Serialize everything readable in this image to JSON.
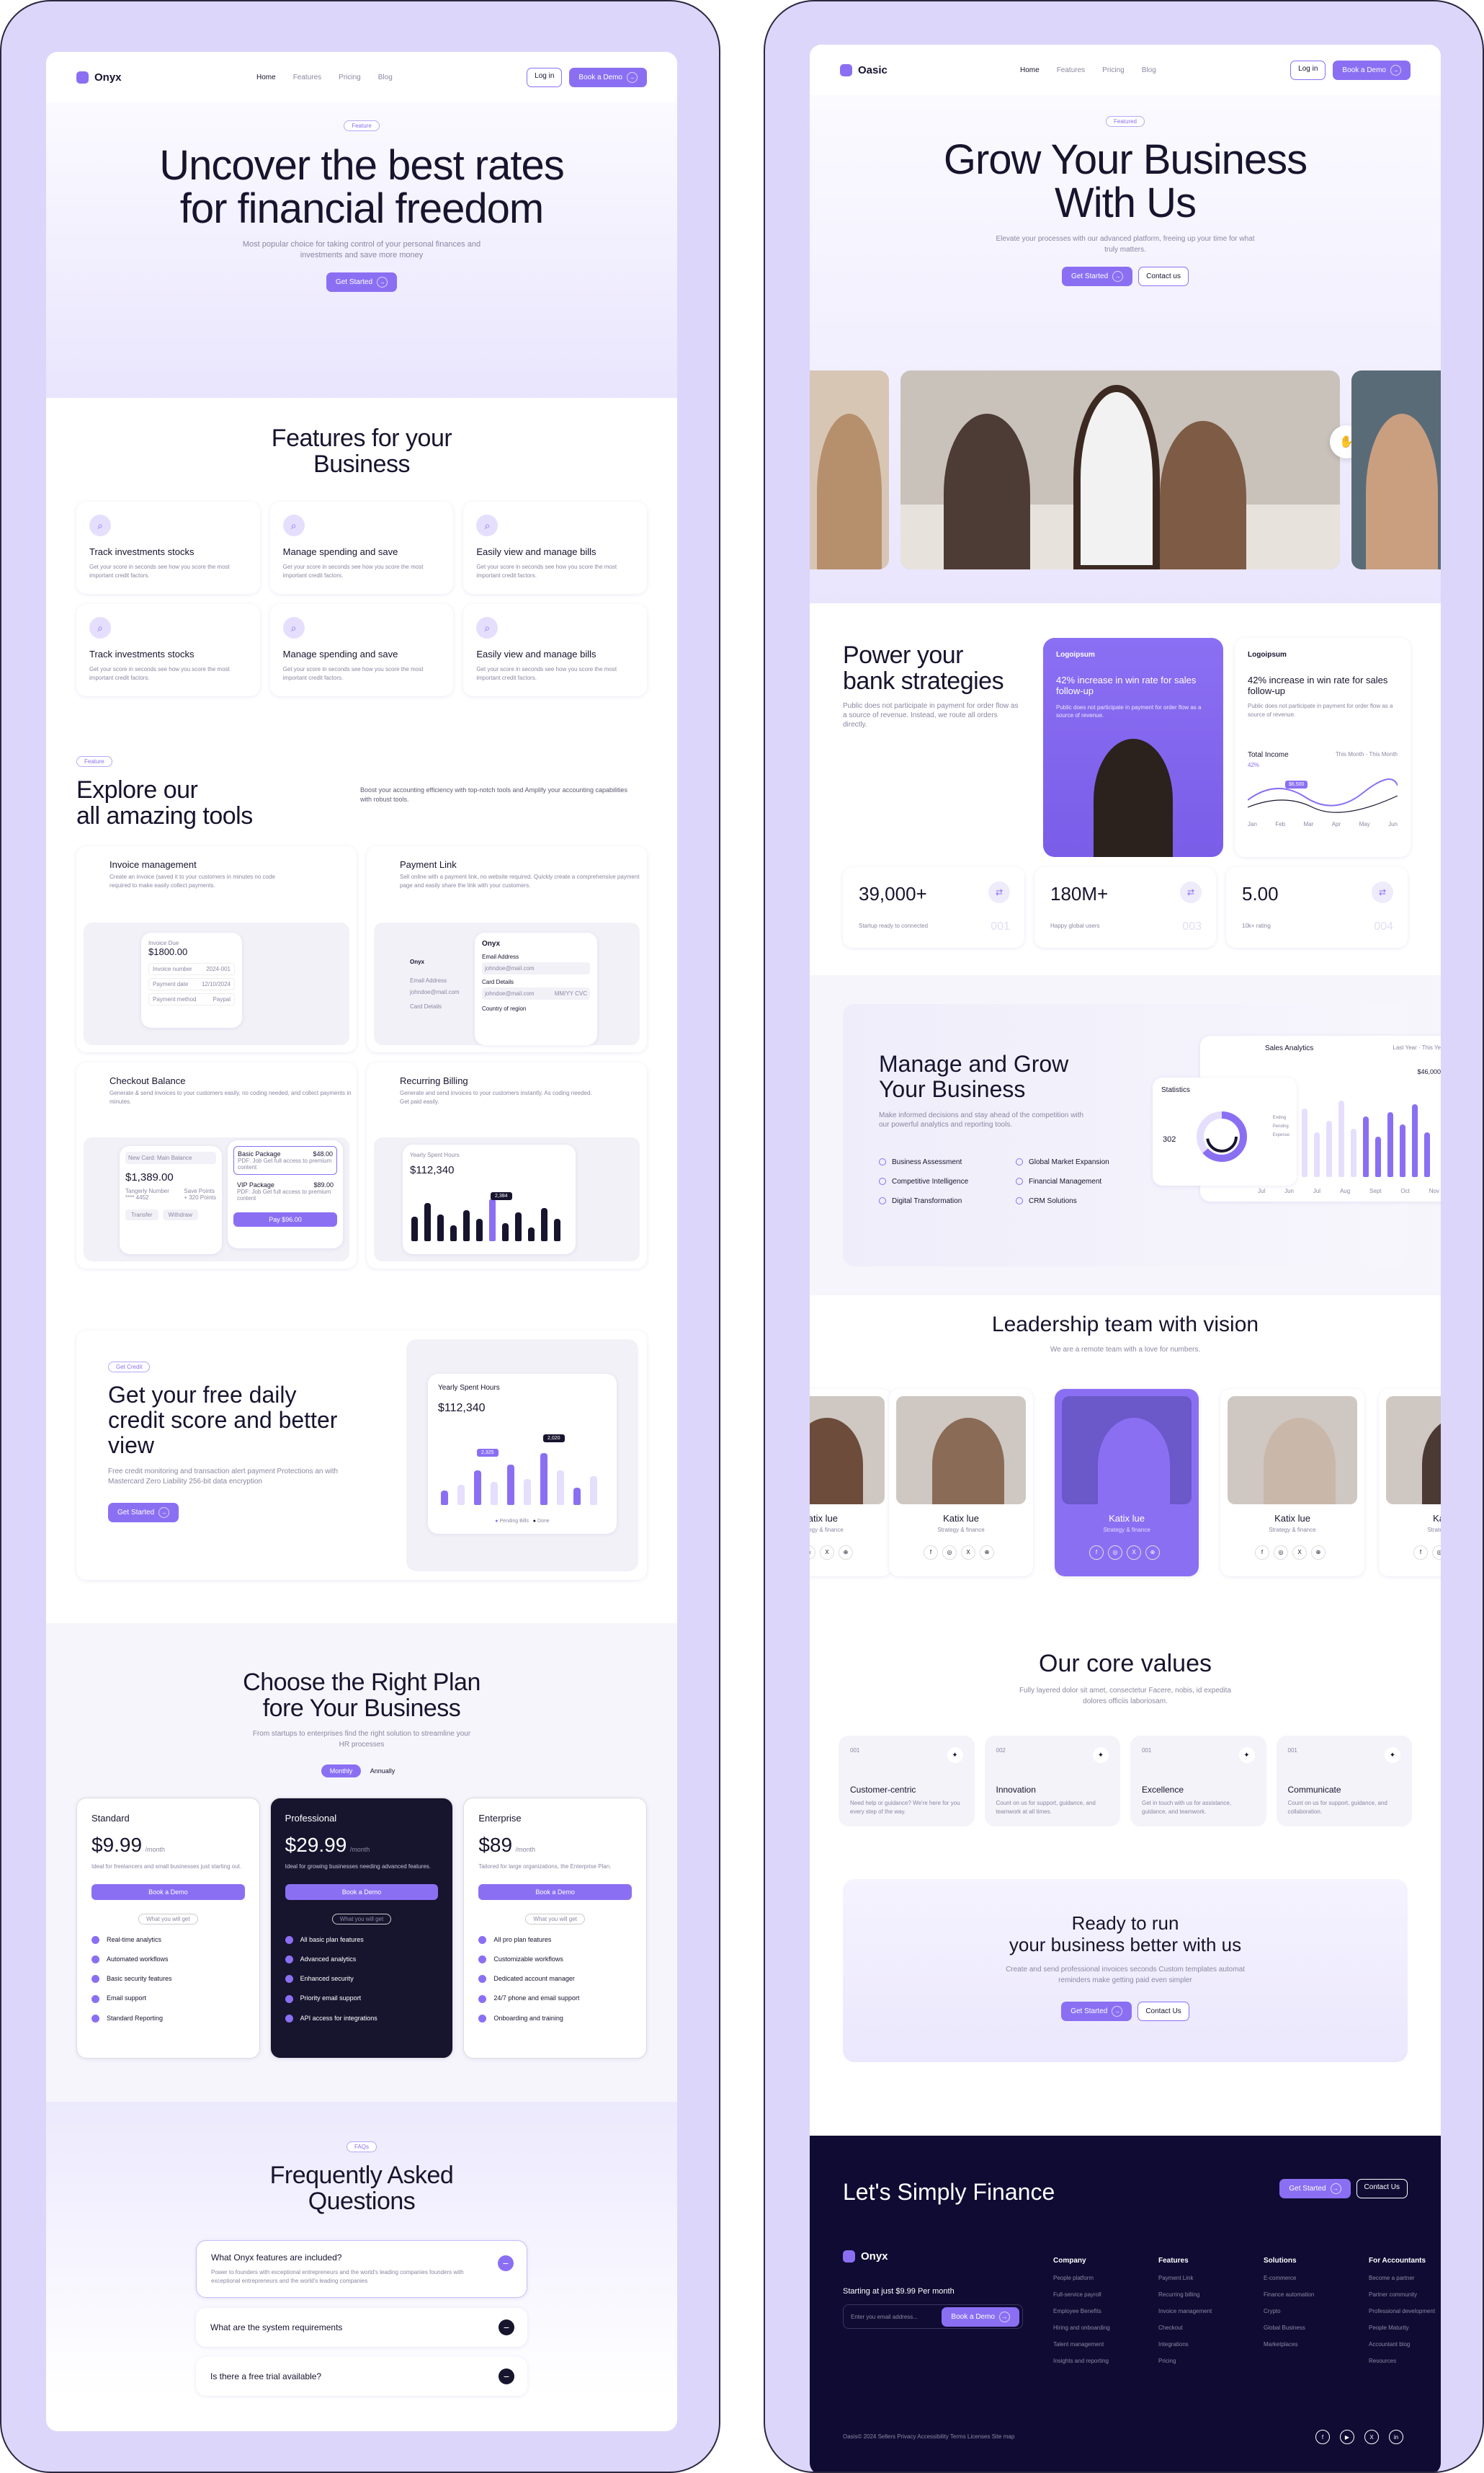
{
  "left": {
    "nav": {
      "brand": "Onyx",
      "links": [
        "Home",
        "Features",
        "Pricing",
        "Blog"
      ],
      "login": "Log in",
      "demo": "Book a Demo"
    },
    "hero": {
      "pill": "Feature",
      "title_line1": "Uncover the best rates",
      "title_line2": "for financial freedom",
      "subtitle_line1": "Most popular choice for taking control of your personal finances and",
      "subtitle_line2": "investments and save more money",
      "cta": "Get Started"
    },
    "features": {
      "title_line1": "Features for your",
      "title_line2": "Business",
      "desc": "Get your score in seconds see how you score the most important credit factors.",
      "items": [
        "Track investments stocks",
        "Manage spending and save",
        "Easily view and manage bills",
        "Track investments stocks",
        "Manage spending and save",
        "Easily view and manage bills"
      ]
    },
    "tools": {
      "pill": "Feature",
      "title_line1": "Explore our",
      "title_line2": "all amazing tools",
      "desc": "Boost your accounting efficiency with top-notch tools and Amplify your accounting capabilities with robust tools.",
      "invoice": {
        "title": "Invoice management",
        "desc": "Create an invoice (saved it to your customers in minutes no code required to make easily collect payments.",
        "amount_label": "Invoice Due",
        "amount": "$1800.00",
        "rows": [
          "Invoice number",
          "Payment date",
          "Payment method"
        ],
        "vals": [
          "2024-001",
          "12/10/2024",
          "Paypal"
        ]
      },
      "payment": {
        "title": "Payment Link",
        "desc": "Sell online with a payment link, no website required. Quickly create a comprehensive payment page and easily share the link with your customers.",
        "brand": "Onyx",
        "email_label": "Email Address",
        "email_val": "johndoe@mail.com",
        "card_label": "Card Details",
        "card_val": "johndoe@mail.com",
        "card_exp": "MM/YY  CVC",
        "country": "Country of region",
        "bg_email": "Email Address",
        "bg_val": "johndoe@mail.com",
        "bg_card": "Card Details"
      },
      "checkout": {
        "title": "Checkout Balance",
        "desc": "Generate & send invoices to your customers easily, no coding needed, and collect payments in minutes.",
        "select": "New Card: Main Balance",
        "amount": "$1,389.00",
        "acct_label": "Tangerly Number",
        "acct_val": "**** 4452",
        "rec_label": "Save Points",
        "rec_val": "+ 320 Points",
        "transfer": "Transfer",
        "withdraw": "Withdraw",
        "plan1": "Basic Package",
        "plan1_price": "$48.00",
        "plan1_desc": "PDF: Job  Get full access to premium content",
        "plan2": "VIP Package",
        "plan2_price": "$89.00",
        "plan2_desc": "PDF: Job  Get full access to premium content",
        "pay": "Pay $96.00"
      },
      "billing": {
        "title": "Recurring Billing",
        "desc": "Generate and send invoices to your customers instantly. As coding needed. Get paid easily.",
        "chart_title": "Yearly Spent Hours",
        "amount": "$112,340",
        "tooltip": "2,384"
      }
    },
    "credit": {
      "pill": "Get Credit",
      "title_line1": "Get your free daily",
      "title_line2": "credit score and better",
      "title_line3": "view",
      "desc": "Free credit monitoring and transaction alert payment Protections an with Mastercard Zero Liability 256-bit data encryption",
      "cta": "Get Started",
      "chart_title": "Yearly Spent Hours",
      "amount": "$112,340",
      "tip1": "2,325",
      "tip2": "2,020",
      "legend": [
        "Pending Bills",
        "Done"
      ]
    },
    "pricing": {
      "title_line1": "Choose the Right Plan",
      "title_line2": "fore Your Business",
      "subtitle_line1": "From startups to enterprises find the right solution to streamline your",
      "subtitle_line2": "HR processes",
      "toggle": [
        "Monthly",
        "Annually"
      ],
      "plans": [
        {
          "name": "Standard",
          "price": "$9.99",
          "per": "/month",
          "desc": "Ideal for freelancers and small businesses just starting out.",
          "cta": "Book a Demo",
          "what": "What you will get",
          "features": [
            "Real-time analytics",
            "Automated workflows",
            "Basic security features",
            "Email support",
            "Standard Reporting"
          ]
        },
        {
          "name": "Professional",
          "price": "$29.99",
          "per": "/month",
          "desc": "Ideal for growing businesses needing advanced features.",
          "cta": "Book a Demo",
          "what": "What you will get",
          "features": [
            "All basic plan features",
            "Advanced analytics",
            "Enhanced security",
            "Priority email support",
            "API access for integrations"
          ]
        },
        {
          "name": "Enterprise",
          "price": "$89",
          "per": "/month",
          "desc": "Tailored for large organizations, the Enterprise Plan.",
          "cta": "Book a Demo",
          "what": "What you will get",
          "features": [
            "All pro plan features",
            "Customizable workflows",
            "Dedicated account manager",
            "24/7 phone and email support",
            "Onboarding and training"
          ]
        }
      ]
    },
    "faq": {
      "pill": "FAQs",
      "title_line1": "Frequently Asked",
      "title_line2": "Questions",
      "q1": "What Onyx features are included?",
      "a1": "Power to founders with exceptional entrepreneurs and the world's leading companies founders with exceptional entrepreneurs and the world's leading companies",
      "q2": "What are the system requirements",
      "q3": "Is there a free trial available?"
    }
  },
  "right": {
    "nav": {
      "brand": "Oasic",
      "links": [
        "Home",
        "Features",
        "Pricing",
        "Blog"
      ],
      "login": "Log in",
      "demo": "Book a Demo"
    },
    "hero": {
      "pill": "Featured",
      "title_line1": "Grow Your Business",
      "title_line2": "With Us",
      "subtitle_line1": "Elevate your processes with our advanced platform, freeing up your time for what",
      "subtitle_line2": "truly matters.",
      "cta1": "Get Started",
      "cta2": "Contact us"
    },
    "strategies": {
      "title_line1": "Power your",
      "title_line2": "bank strategies",
      "desc": "Public does not participate in payment for order flow as a source of revenue. Instead, we route all orders directly.",
      "card1_brand": "Logoipsum",
      "card1_stat": "42% increase in win rate for sales follow-up",
      "card1_desc": "Public does not participate in payment for order flow as a source of revenue.",
      "card2_brand": "Logoipsum",
      "card2_stat": "42% increase in win rate for sales follow-up",
      "card2_desc": "Public does not participate in payment for order flow as a source of revenue.",
      "chart_title": "Total Income",
      "legend": [
        "This Month",
        "This Month"
      ],
      "months": [
        "Jan",
        "Feb",
        "Mar",
        "Apr",
        "May",
        "Jun"
      ],
      "tip": "$6,500",
      "pct": "42%"
    },
    "stats": [
      {
        "value": "39,000+",
        "label": "Startup ready to connected",
        "num": "001"
      },
      {
        "value": "180M+",
        "label": "Happy global users",
        "num": "003"
      },
      {
        "value": "5.00",
        "label": "10k+ rating",
        "num": "004"
      }
    ],
    "manage": {
      "title_line1": "Manage and Grow",
      "title_line2": "Your Business",
      "desc": "Make informed decisions and stay ahead of the competition with our powerful analytics and reporting tools.",
      "items": [
        "Business Assessment",
        "Global Market Expansion",
        "Competitive Intelligence",
        "Financial Management",
        "Digital Transformation",
        "CRM Solutions"
      ],
      "sales_title": "Sales Analytics",
      "sales_legend": [
        "Last Year",
        "This Ye"
      ],
      "sales_value": "$46,000",
      "sales_months": [
        "Jul",
        "Jun",
        "Jul",
        "Aug",
        "Sept",
        "Oct",
        "Nov"
      ],
      "stats_title": "Statistics",
      "stats_value": "302",
      "stats_legend": [
        "Ending",
        "Pending",
        "Expense"
      ]
    },
    "team": {
      "title": "Leadership team with vision",
      "subtitle": "We are a remote team with a love for numbers.",
      "name": "Katix lue",
      "role": "Strategy & finance"
    },
    "values": {
      "title": "Our core values",
      "subtitle_line1": "Fully layered dolor sit amet, consectetur Facere, nobis, id expedita",
      "subtitle_line2": "dolores officiis laboriosam.",
      "items": [
        {
          "num": "001",
          "title": "Customer-centric",
          "desc": "Need help or guidance? We're here for you every step of the way."
        },
        {
          "num": "002",
          "title": "Innovation",
          "desc": "Count on us for support, guidance, and teamwork at all times."
        },
        {
          "num": "001",
          "title": "Excellence",
          "desc": "Get in touch with us for assistance, guidance, and teamwork."
        },
        {
          "num": "001",
          "title": "Communicate",
          "desc": "Count on us for support, guidance, and collaboration."
        }
      ]
    },
    "cta": {
      "title_line1": "Ready to run",
      "title_line2": "your business better with us",
      "desc_line1": "Create and send professional invoices seconds Custom templates automat",
      "desc_line2": "reminders make getting paid even simpler",
      "btn1": "Get Started",
      "btn2": "Contact Us"
    },
    "footer": {
      "title": "Let's Simply Finance",
      "btn1": "Get Started",
      "btn2": "Contact Us",
      "brand": "Onyx",
      "price": "Starting at just $9.99 Per month",
      "email_ph": "Enter you email address...",
      "book": "Book a Demo",
      "cols": [
        {
          "h": "Company",
          "items": [
            "People platform",
            "Full-service payroll",
            "Employee Benefits",
            "Hiring and onboarding",
            "Talent management",
            "Insights and reporting"
          ]
        },
        {
          "h": "Features",
          "items": [
            "Payment Link",
            "Recurring billing",
            "Invoice management",
            "Checkout",
            "Integrations",
            "Pricing"
          ]
        },
        {
          "h": "Solutions",
          "items": [
            "E-commerce",
            "Finance automation",
            "Crypto",
            "Global Business",
            "Marketplaces"
          ]
        },
        {
          "h": "For Accountants",
          "items": [
            "Become a partner",
            "Partner community",
            "Professional development",
            "People Maturity",
            "Accountant blog",
            "Resources"
          ]
        }
      ],
      "legal": "Oasis© 2024  Sellers  Privacy  Accessibility  Terms  Licenses  Site map"
    }
  }
}
